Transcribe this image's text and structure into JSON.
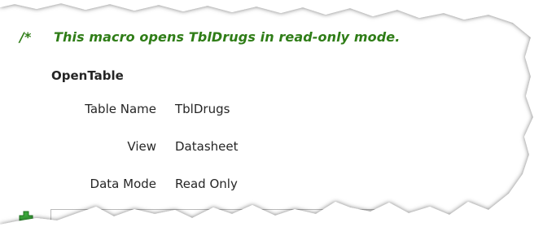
{
  "macro": {
    "comment_marker": "/*",
    "comment_text": "This macro opens TblDrugs in read-only mode.",
    "action_name": "OpenTable",
    "arguments": [
      {
        "label": "Table Name",
        "value": "TblDrugs"
      },
      {
        "label": "View",
        "value": "Datasheet"
      },
      {
        "label": "Data Mode",
        "value": "Read Only"
      }
    ]
  },
  "icons": {
    "add_action": "plus-icon",
    "dropdown": "chevron-down-icon"
  },
  "colors": {
    "comment": "#2f7d17",
    "text": "#262626",
    "add_icon": "#3aa63a"
  }
}
